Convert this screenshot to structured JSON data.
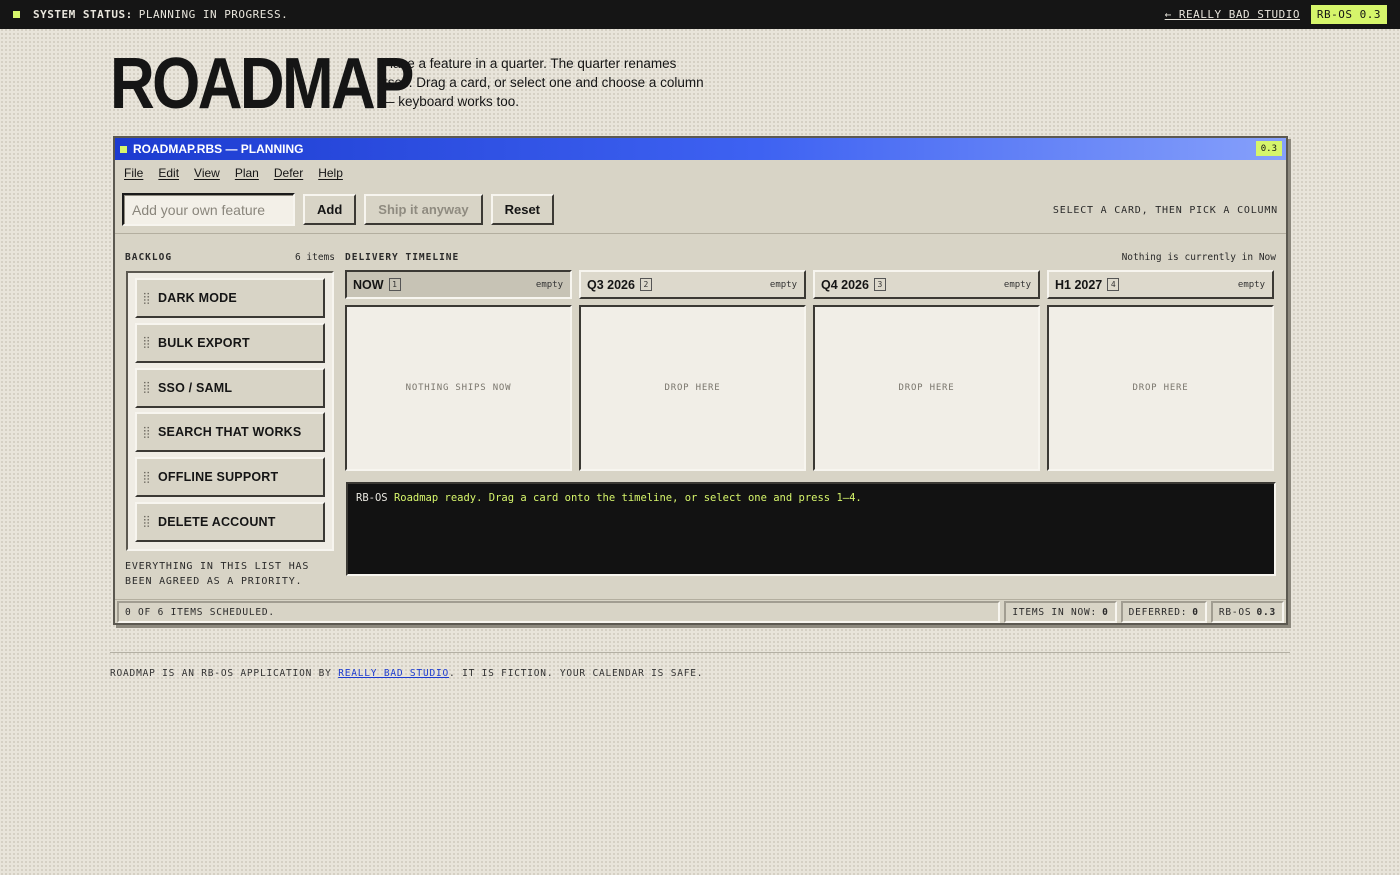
{
  "topbar": {
    "status_label": "SYSTEM STATUS:",
    "status_text": "PLANNING IN PROGRESS.",
    "back_link": "← REALLY BAD STUDIO",
    "version": "RB-OS 0.3"
  },
  "header": {
    "title": "ROADMAP",
    "intro": "Place a feature in a quarter. The quarter renames itself. Drag a card, or select one and choose a column — keyboard works too."
  },
  "window": {
    "title": "ROADMAP.RBS — PLANNING",
    "version": "0.3",
    "menu": [
      "File",
      "Edit",
      "View",
      "Plan",
      "Defer",
      "Help"
    ],
    "toolbar": {
      "input_placeholder": "Add your own feature",
      "input_value": "",
      "add_label": "Add",
      "ship_label": "Ship it anyway",
      "reset_label": "Reset",
      "hint": "SELECT A CARD, THEN PICK A COLUMN"
    },
    "backlog": {
      "label": "BACKLOG",
      "count": "6 items",
      "items": [
        "DARK MODE",
        "BULK EXPORT",
        "SSO / SAML",
        "SEARCH THAT WORKS",
        "OFFLINE SUPPORT",
        "DELETE ACCOUNT"
      ],
      "note": "EVERYTHING IN THIS LIST HAS BEEN AGREED AS A PRIORITY."
    },
    "timeline": {
      "label": "DELIVERY TIMELINE",
      "now_status": "Nothing is currently in Now",
      "columns": [
        {
          "name": "NOW",
          "key": "1",
          "state": "empty",
          "placeholder": "NOTHING SHIPS NOW"
        },
        {
          "name": "Q3 2026",
          "key": "2",
          "state": "empty",
          "placeholder": "DROP HERE"
        },
        {
          "name": "Q4 2026",
          "key": "3",
          "state": "empty",
          "placeholder": "DROP HERE"
        },
        {
          "name": "H1 2027",
          "key": "4",
          "state": "empty",
          "placeholder": "DROP HERE"
        }
      ]
    },
    "console": {
      "prefix": "RB-OS",
      "message": "Roadmap ready. Drag a card onto the timeline, or select one and press 1–4."
    },
    "statusbar": {
      "scheduled": "0 OF 6 ITEMS SCHEDULED.",
      "in_now_label": "ITEMS IN NOW:",
      "in_now_value": "0",
      "deferred_label": "DEFERRED:",
      "deferred_value": "0",
      "os_label": "RB-OS",
      "os_version": "0.3"
    }
  },
  "footer": {
    "prefix": "ROADMAP IS AN RB-OS APPLICATION BY ",
    "link": "REALLY BAD STUDIO",
    "suffix": ". IT IS FICTION. YOUR CALENDAR IS SAFE."
  },
  "colors": {
    "accent_lime": "#d6f56b",
    "titlebar_blue": "#1c3bd0",
    "background": "#e8e4da",
    "ink": "#151515"
  }
}
